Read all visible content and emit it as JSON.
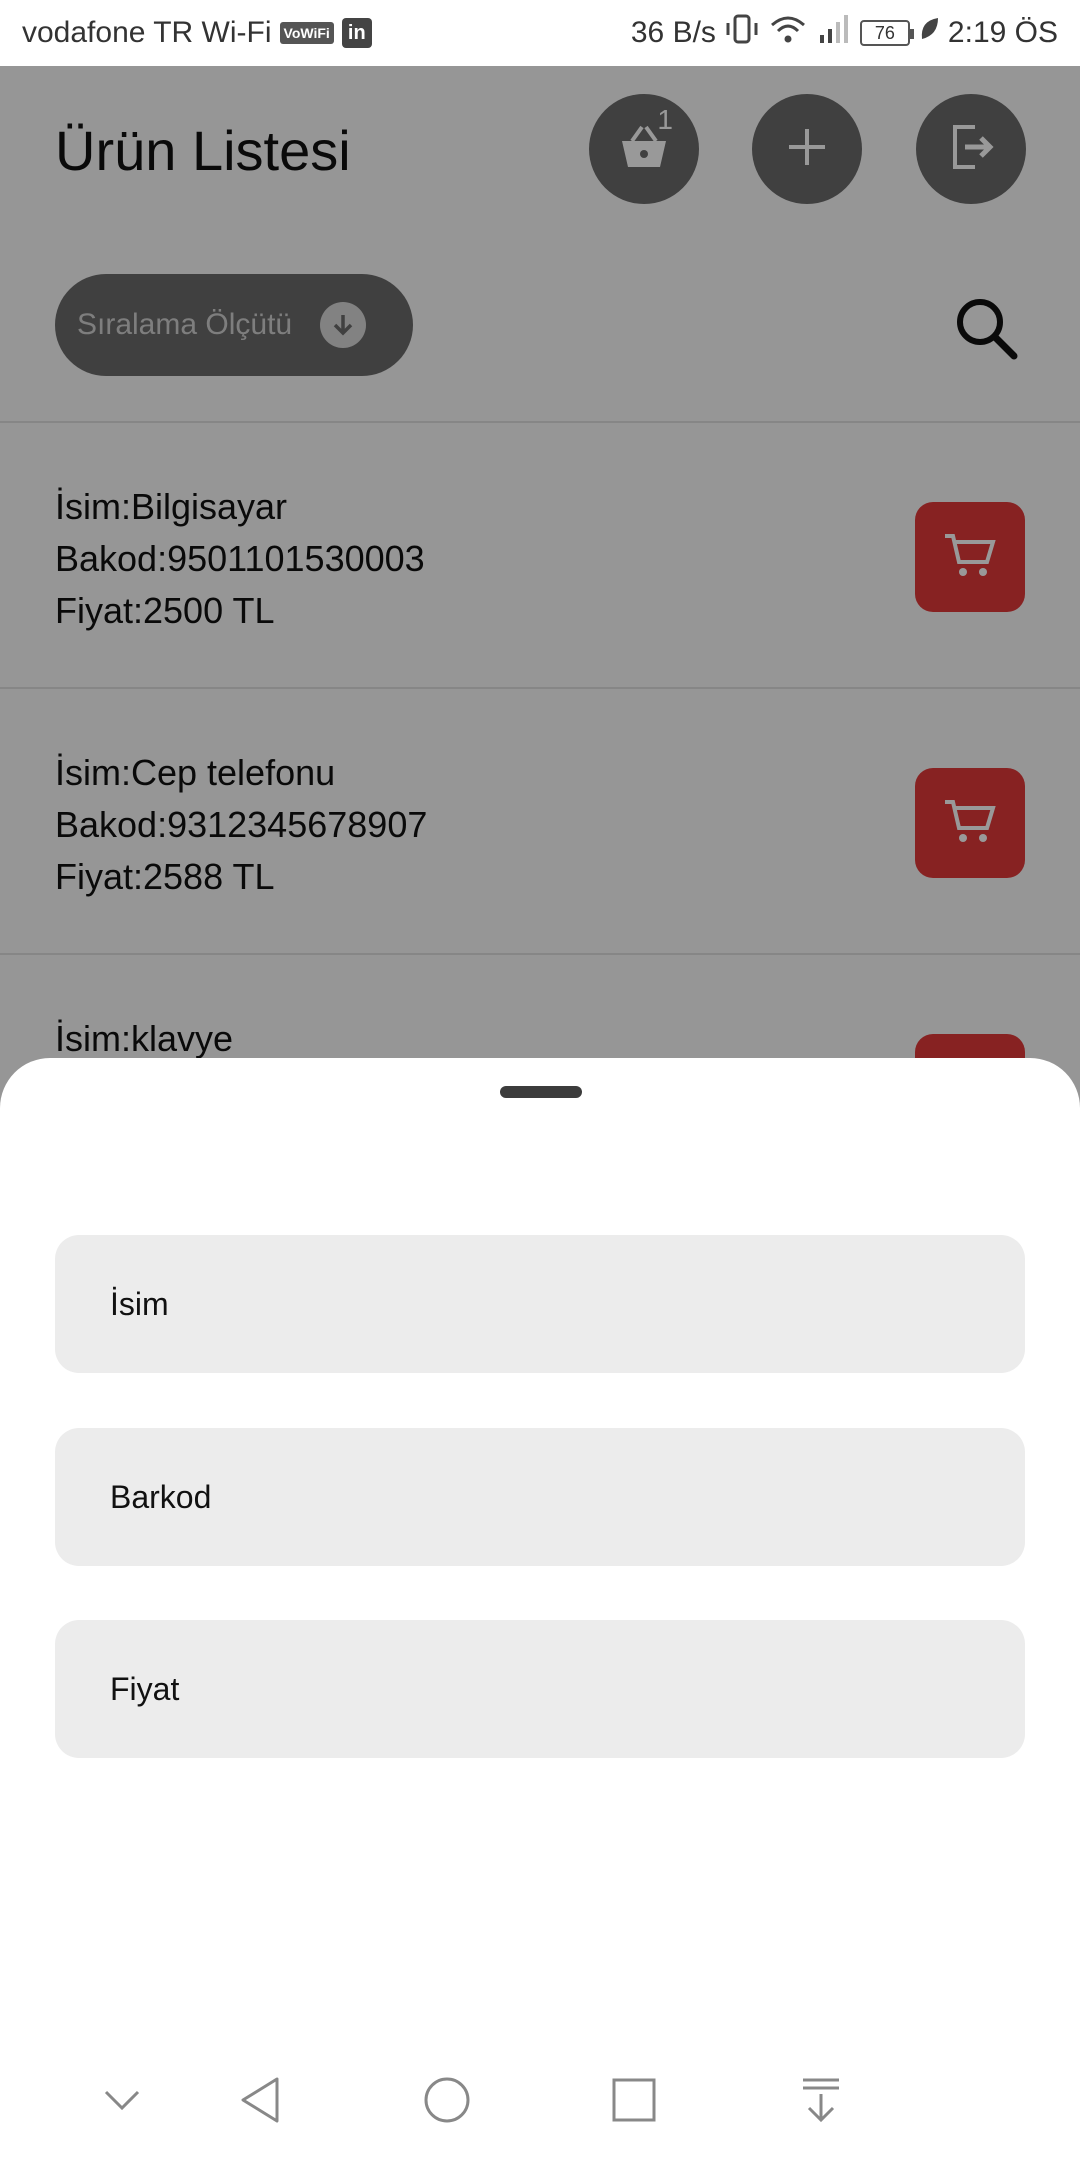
{
  "status_bar": {
    "carrier": "vodafone TR Wi-Fi",
    "vowifi_badge": "VoWiFi",
    "linkedin_badge": "in",
    "speed": "36 B/s",
    "battery": "76",
    "time": "2:19 ÖS",
    "icons": [
      "vibrate-icon",
      "wifi-icon",
      "signal-icon",
      "battery-icon",
      "leaf-icon"
    ]
  },
  "header": {
    "title": "Ürün Listesi",
    "basket_count": "1",
    "buttons": [
      "basket-icon",
      "add-icon",
      "logout-icon"
    ]
  },
  "sort": {
    "placeholder": "Sıralama Ölçütü"
  },
  "products": [
    {
      "name": "İsim:Bilgisayar",
      "barcode": "Bakod:9501101530003",
      "price": "Fiyat:2500 TL"
    },
    {
      "name": "İsim:Cep telefonu",
      "barcode": "Bakod:9312345678907",
      "price": "Fiyat:2588 TL"
    },
    {
      "name": "İsim:klavye",
      "barcode": "",
      "price": ""
    }
  ],
  "sheet": {
    "options": [
      "İsim",
      "Barkod",
      "Fiyat"
    ]
  },
  "nav": {
    "icons": [
      "chevron-down-icon",
      "back-icon",
      "home-icon",
      "recents-icon",
      "notification-pull-icon"
    ]
  },
  "colors": {
    "accent_red": "#e23a3a",
    "dark_button": "#6b6b6b",
    "option_bg": "#ececec"
  }
}
